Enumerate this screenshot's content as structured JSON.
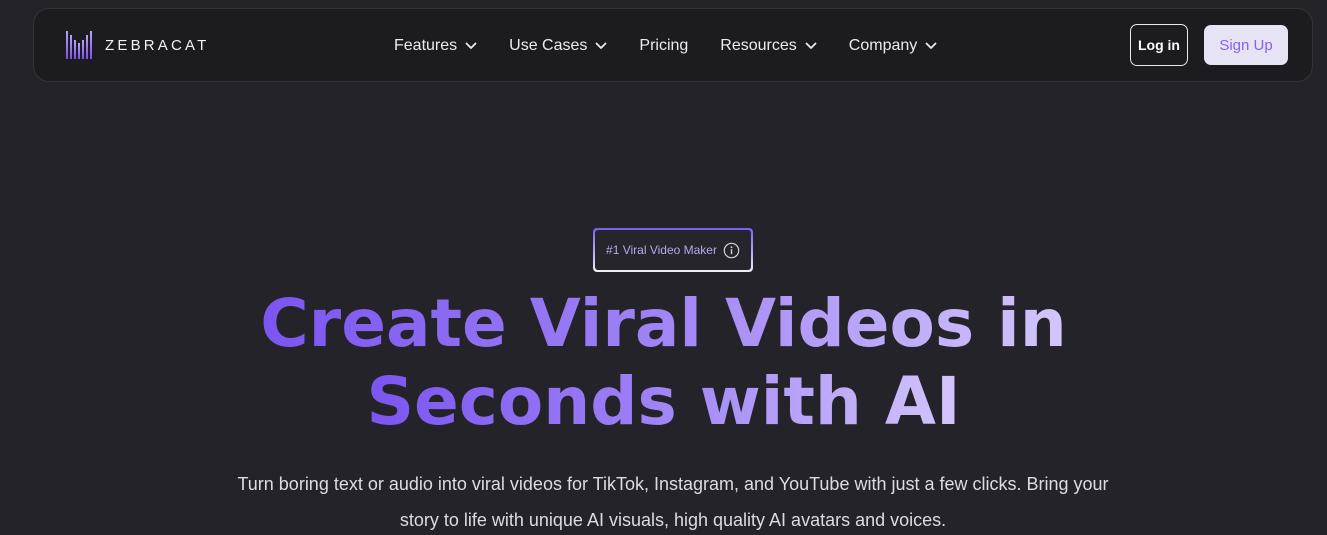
{
  "brand": {
    "name": "ZEBRACAT",
    "accent": "#8a5ff0"
  },
  "nav": {
    "items": [
      {
        "label": "Features",
        "has_dropdown": true
      },
      {
        "label": "Use Cases",
        "has_dropdown": true
      },
      {
        "label": "Pricing",
        "has_dropdown": false
      },
      {
        "label": "Resources",
        "has_dropdown": true
      },
      {
        "label": "Company",
        "has_dropdown": true
      }
    ],
    "login_label": "Log in",
    "signup_label": "Sign Up"
  },
  "hero": {
    "badge": "#1 Viral Video Maker",
    "headline_line1": "Create Viral Videos in",
    "headline_line2": "Seconds with AI",
    "subtitle_line1": "Turn boring text or audio into viral videos for TikTok, Instagram, and YouTube with just a few clicks. Bring your",
    "subtitle_line2": "story to life with unique AI visuals, high quality AI avatars and voices."
  },
  "colors": {
    "background": "#242329",
    "nav_background": "#1c1b20",
    "headline_start": "#7a55f0",
    "headline_end": "#d3c6fa"
  }
}
